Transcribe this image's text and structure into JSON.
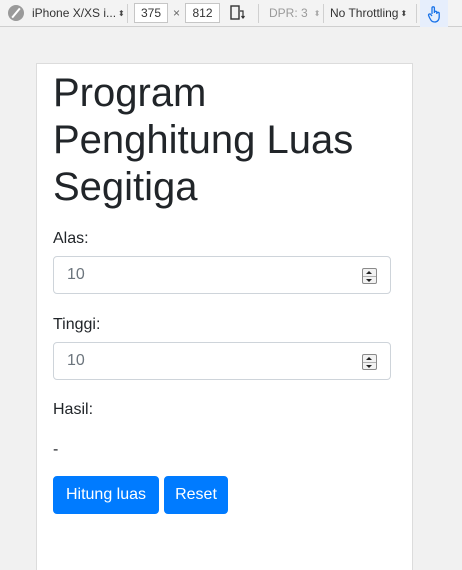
{
  "toolbar": {
    "device": "iPhone X/XS i...",
    "width": "375",
    "times": "×",
    "height": "812",
    "dpr": "DPR: 3",
    "throttling": "No Throttling"
  },
  "page": {
    "title": "Program Penghitung Luas Segitiga",
    "alas_label": "Alas:",
    "alas_value": "10",
    "tinggi_label": "Tinggi:",
    "tinggi_value": "10",
    "hasil_label": "Hasil:",
    "hasil_value": "-",
    "hitung_button": "Hitung luas",
    "reset_button": "Reset"
  },
  "colors": {
    "primary": "#007bff",
    "text": "#212529",
    "input_text": "#6c757d"
  },
  "icons": {
    "rotate": "rotate-icon",
    "touch": "touch-hand-icon",
    "no_device": "circle-slash-icon"
  }
}
